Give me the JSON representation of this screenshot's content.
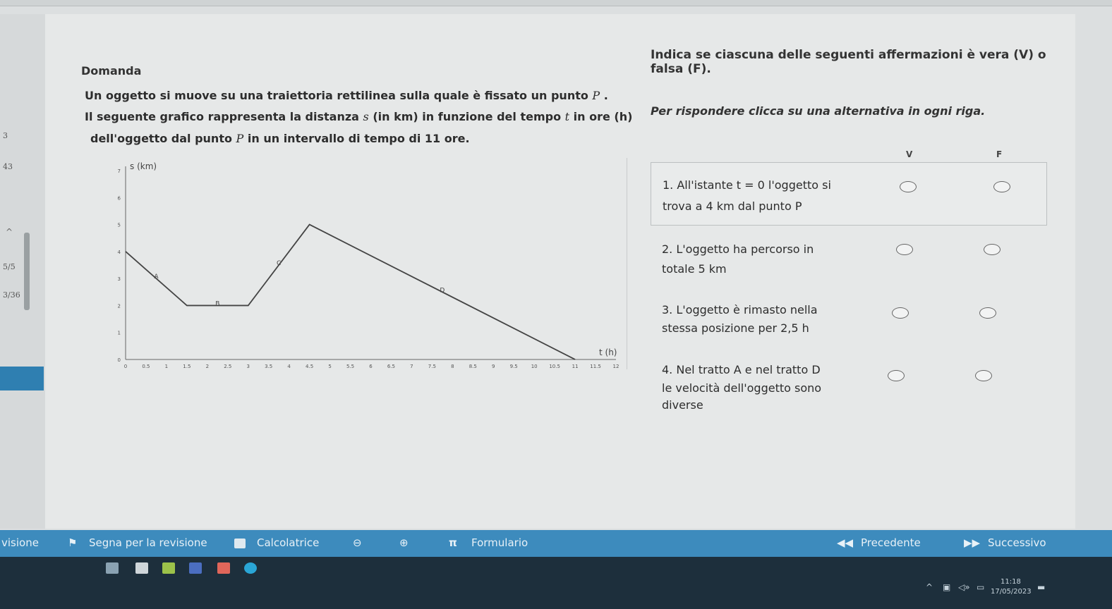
{
  "sidebar": {
    "labels": [
      "3",
      "43",
      "5/5",
      "3/36"
    ]
  },
  "question": {
    "title": "Domanda",
    "line1": "Un oggetto si muove su una traiettoria rettilinea sulla quale è fissato un punto",
    "line1_var": "P",
    "line1_end": ".",
    "line2_a": "Il seguente grafico rappresenta la distanza",
    "line2_s": "s",
    "line2_b": "(in km) in funzione del tempo",
    "line2_t": "t",
    "line2_c": "in ore (h)",
    "line3_a": "dell'oggetto dal punto",
    "line3_p": "P",
    "line3_b": "in un intervallo di tempo di 11 ore."
  },
  "instructions": {
    "line1": "Indica se ciascuna delle seguenti affermazioni è vera (V) o falsa (F).",
    "line2": "Per rispondere clicca su una alternativa in ogni riga."
  },
  "columns": {
    "v": "V",
    "f": "F"
  },
  "statements": [
    {
      "line1": "1. All'istante t = 0 l'oggetto si",
      "line2": "trova a 4 km dal punto P",
      "line3": ""
    },
    {
      "line1": "2. L'oggetto ha percorso in",
      "line2": "totale 5 km",
      "line3": ""
    },
    {
      "line1": "3. L'oggetto è rimasto nella",
      "line2": "stessa posizione per 2,5 h",
      "line3": ""
    },
    {
      "line1": "4. Nel tratto A e nel tratto D",
      "line2": "le velocità dell'oggetto sono",
      "line3": "diverse"
    }
  ],
  "chart_data": {
    "type": "line",
    "ylabel": "s (km)",
    "xlabel": "t (h)",
    "xlim": [
      0,
      12
    ],
    "ylim": [
      0,
      7
    ],
    "x_ticks": [
      "0",
      "0.5",
      "1",
      "1.5",
      "2",
      "2.5",
      "3",
      "3.5",
      "4",
      "4.5",
      "5",
      "5.5",
      "6",
      "6.5",
      "7",
      "7.5",
      "8",
      "8.5",
      "9",
      "9.5",
      "10",
      "10.5",
      "11",
      "11.5",
      "12"
    ],
    "y_ticks": [
      "0",
      "1",
      "2",
      "3",
      "4",
      "5",
      "6",
      "7"
    ],
    "series": [
      {
        "x": [
          0,
          1.5,
          3,
          4.5,
          11
        ],
        "y": [
          4,
          2,
          2,
          5,
          0
        ]
      }
    ],
    "segment_labels": [
      {
        "text": "A",
        "x": 0.75,
        "y": 3
      },
      {
        "text": "B",
        "x": 2.25,
        "y": 2
      },
      {
        "text": "C",
        "x": 3.75,
        "y": 3.5
      },
      {
        "text": "D",
        "x": 7.75,
        "y": 2.5
      }
    ]
  },
  "bottom_bar": {
    "visione": "visione",
    "segna": "Segna per la revisione",
    "calcolatrice": "Calcolatrice",
    "formulario": "Formulario",
    "pi": "π",
    "precedente": "Precedente",
    "successivo": "Successivo"
  },
  "clock": {
    "time": "11:18",
    "date": "17/05/2023"
  },
  "colors": {
    "accent": "#3d8bbd",
    "taskbar": "#1d2f3c"
  }
}
